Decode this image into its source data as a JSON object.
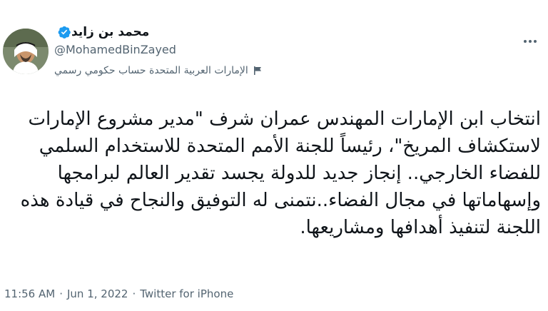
{
  "author": {
    "display_name": "محمد بن زايد",
    "handle": "@MohamedBinZayed",
    "affiliation_label": "الإمارات العربية المتحدة حساب حكومي رسمي"
  },
  "tweet": {
    "text": "انتخاب ابن الإمارات المهندس عمران شرف \"مدير مشروع الإمارات لاستكشاف المريخ\"، رئيساً للجنة الأمم المتحدة للاستخدام السلمي للفضاء الخارجي.. إنجاز جديد للدولة يجسد تقدير العالم لبرامجها وإسهاماتها في مجال الفضاء..نتمنى له التوفيق والنجاح في قيادة هذه اللجنة لتنفيذ أهدافها ومشاريعها."
  },
  "meta": {
    "time": "11:56 AM",
    "separator1": "·",
    "date": "Jun 1, 2022",
    "separator2": "·",
    "source": "Twitter for iPhone"
  },
  "icons": {
    "verified": "verified-badge-icon",
    "more": "more-options-icon",
    "flag": "government-flag-icon"
  },
  "colors": {
    "verified_blue": "#1d9bf0",
    "secondary_text": "#536471",
    "primary_text": "#0f1419"
  }
}
